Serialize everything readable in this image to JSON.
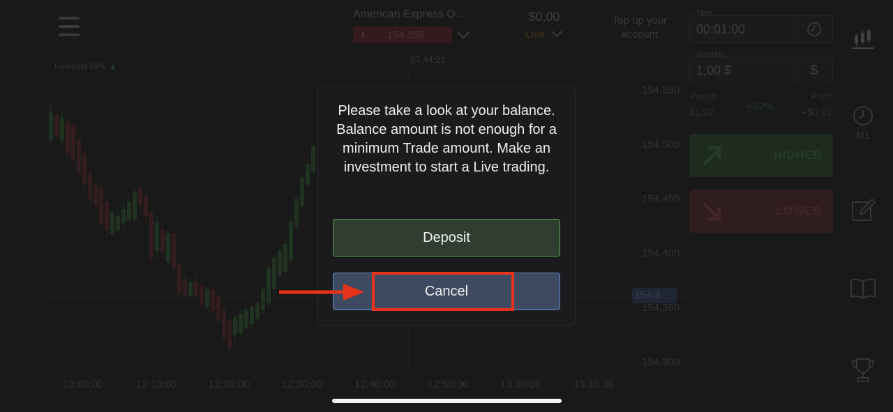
{
  "header": {
    "asset_name": "American Express O...",
    "asset_price": "154.359",
    "balance_amount": "$0,00",
    "balance_mode": "Live",
    "top_up": "Top up your account",
    "server_time": "07:44:21"
  },
  "chart": {
    "forecast": "Forecast 89%",
    "current_price_label": "154.3...",
    "y_ticks": [
      "154,550",
      "154,500",
      "154,450",
      "154,400",
      "154,350",
      "154,300"
    ],
    "x_ticks": [
      "12:00:00",
      "12:10:00",
      "12:20:00",
      "12:30:00",
      "12:40:00",
      "12:50:00",
      "13:00:00",
      "13:10:00"
    ]
  },
  "trade_panel": {
    "time_label": "Time",
    "time_value": "00:01:00",
    "amount_label": "Amount",
    "amount_value": "1,00 $",
    "amount_currency": "$",
    "payout_label": "Payout:",
    "payout_value": "$1,92",
    "payout_percent": "+92%",
    "profit_label": "Profit:",
    "profit_value": "+$0,92",
    "higher_label": "HIGHER",
    "lower_label": "LOWER"
  },
  "sidebar": {
    "timeframe_label": "M1"
  },
  "modal": {
    "message": "Please take a look at your balance. Balance amount is not enough for a minimum Trade amount. Make an investment to start a Live trading.",
    "deposit_label": "Deposit",
    "cancel_label": "Cancel"
  },
  "colors": {
    "background": "#1f1f21",
    "deposit_border": "#5a9a50",
    "cancel_border": "#5f8fcc",
    "highlight": "#e8331c",
    "higher": "#2c4a2c",
    "lower": "#52282a"
  },
  "icons": [
    "menu-icon",
    "arrow-down-icon",
    "chevron-down-icon",
    "clock-icon",
    "dollar-icon",
    "candlestick-icon",
    "timer-icon",
    "edit-icon",
    "book-icon",
    "trophy-icon",
    "arrow-up-right-icon",
    "arrow-down-right-icon"
  ]
}
